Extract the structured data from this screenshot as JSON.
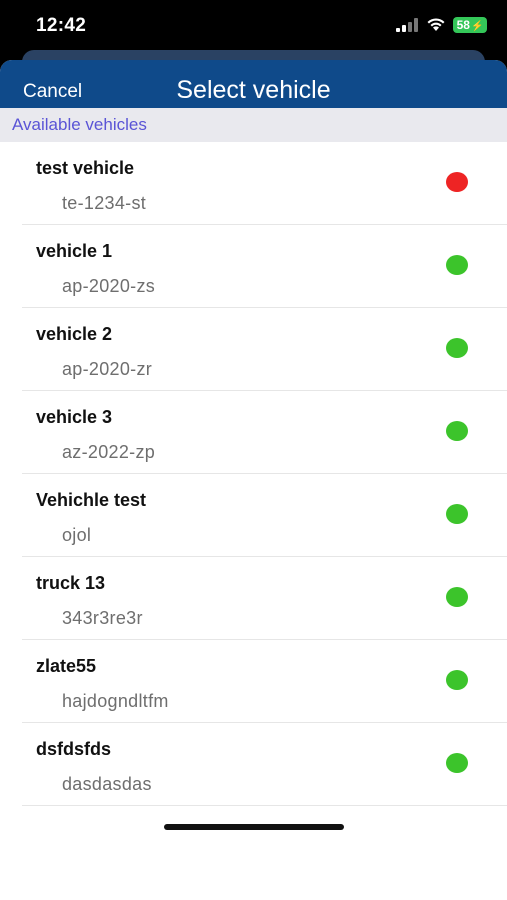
{
  "status_bar": {
    "time": "12:42",
    "battery": "58"
  },
  "nav": {
    "cancel_label": "Cancel",
    "title": "Select vehicle"
  },
  "section": {
    "header": "Available vehicles"
  },
  "colors": {
    "nav_bg": "#0f4a8a",
    "status_available": "#3cc42b",
    "status_unavailable": "#ee2424",
    "section_text": "#5a54d6"
  },
  "vehicles": [
    {
      "name": "test vehicle",
      "plate": "te-1234-st",
      "status_color": "#ee2424"
    },
    {
      "name": "vehicle 1",
      "plate": "ap-2020-zs",
      "status_color": "#3cc42b"
    },
    {
      "name": "vehicle 2",
      "plate": "ap-2020-zr",
      "status_color": "#3cc42b"
    },
    {
      "name": "vehicle 3",
      "plate": "az-2022-zp",
      "status_color": "#3cc42b"
    },
    {
      "name": "Vehichle test",
      "plate": "ojol",
      "status_color": "#3cc42b"
    },
    {
      "name": "truck 13",
      "plate": "343r3re3r",
      "status_color": "#3cc42b"
    },
    {
      "name": "zlate55",
      "plate": "hajdogndltfm",
      "status_color": "#3cc42b"
    },
    {
      "name": "dsfdsfds",
      "plate": "dasdasdas",
      "status_color": "#3cc42b"
    }
  ]
}
